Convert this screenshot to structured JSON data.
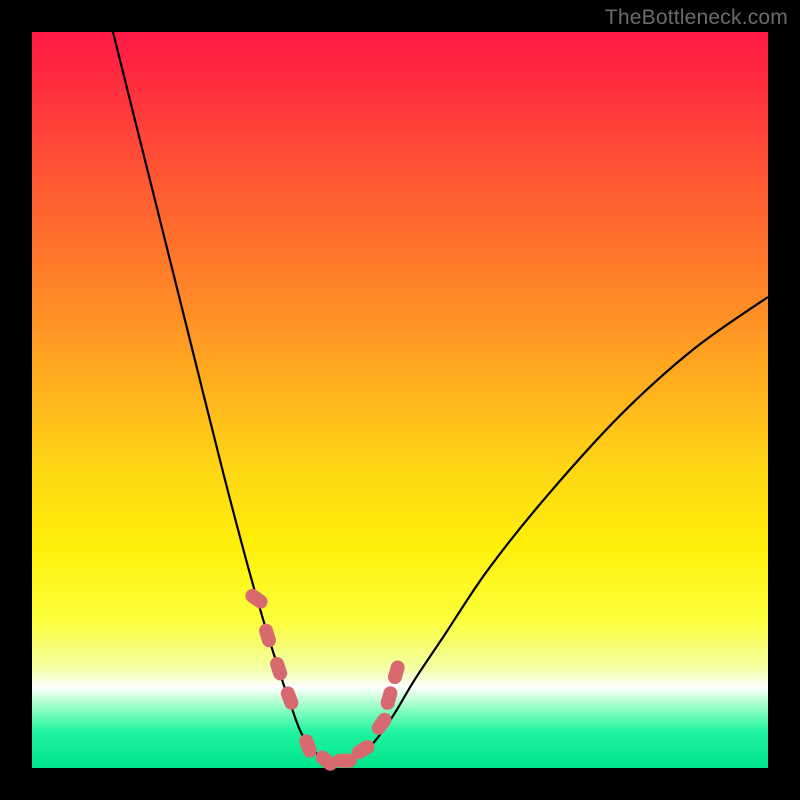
{
  "watermark": {
    "text": "TheBottleneck.com"
  },
  "colors": {
    "curve": "#000000",
    "markers": "#d86a6f",
    "gradient_top": "#ff1a45",
    "gradient_bottom": "#00e58c"
  },
  "chart_data": {
    "type": "line",
    "title": "",
    "xlabel": "",
    "ylabel": "",
    "xlim": [
      0,
      100
    ],
    "ylim": [
      0,
      100
    ],
    "note": "Values estimated from pixel positions; x is horizontal percent across the colored plot area (left=0, right=100). y is bottleneck percent where 0=bottom (best / green) and 100=top (worst / red). Curve drops steeply on the left, bottoms out ~38–45, rises more gently on the right.",
    "series": [
      {
        "name": "bottleneck_curve",
        "x": [
          11,
          14,
          18,
          22,
          26,
          30,
          33,
          35,
          37,
          40,
          43,
          46,
          49,
          52,
          56,
          62,
          70,
          80,
          90,
          100
        ],
        "y": [
          100,
          88,
          72,
          56,
          40,
          25,
          15,
          9,
          4,
          1,
          1,
          3,
          7,
          12,
          18,
          27,
          37,
          48,
          57,
          64
        ]
      }
    ],
    "markers": {
      "name": "highlighted_points",
      "note": "Coral rounded dashes near the valley; same coordinate system as the curve.",
      "x": [
        30.5,
        32.0,
        33.5,
        35.0,
        37.5,
        40.0,
        42.5,
        45.0,
        47.5,
        48.5,
        49.5
      ],
      "y": [
        23.0,
        18.0,
        13.5,
        9.5,
        3.0,
        1.0,
        1.0,
        2.5,
        6.0,
        9.5,
        13.0
      ]
    }
  }
}
